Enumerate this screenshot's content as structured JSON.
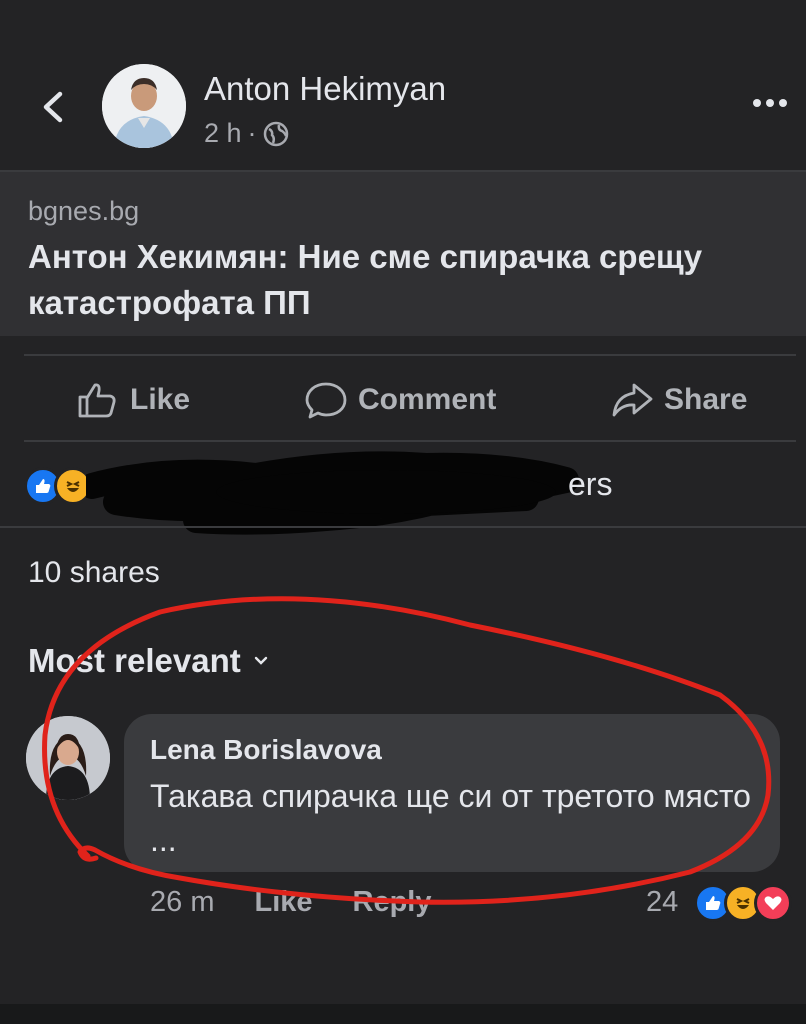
{
  "header": {
    "back_icon": "chevron-left-icon",
    "author": "Anton Hekimyan",
    "time": "2 h",
    "separator": "·",
    "audience_icon": "globe-icon",
    "more_icon": "more-horizontal-icon"
  },
  "link_preview": {
    "source": "bgnes.bg",
    "headline": "Антон Хекимян: Ние сме спирачка срещу катастрофата ПП"
  },
  "actions": [
    {
      "label": "Like",
      "icon": "thumbs-up-icon"
    },
    {
      "label": "Comment",
      "icon": "comment-icon"
    },
    {
      "label": "Share",
      "icon": "share-icon"
    }
  ],
  "reactions": {
    "icons": [
      "like-reaction-icon",
      "haha-reaction-icon"
    ],
    "summary_visible_fragment": "ers"
  },
  "shares": "10 shares",
  "comments": {
    "sort_label": "Most relevant",
    "items": [
      {
        "author": "Lena Borislavova",
        "text": "Такава спирачка ще си от третото място ...",
        "time": "26 m",
        "like_label": "Like",
        "reply_label": "Reply",
        "reaction_count": "24",
        "reaction_icons": [
          "like-reaction-icon",
          "haha-reaction-icon",
          "love-reaction-icon"
        ]
      }
    ]
  },
  "colors": {
    "background": "#232325",
    "preview_bg": "#303033",
    "bubble_bg": "#3a3b3e",
    "like_blue": "#1877f2",
    "love_red": "#f33e58",
    "haha_yellow": "#f7b125",
    "annotation_red": "#e0231b"
  }
}
